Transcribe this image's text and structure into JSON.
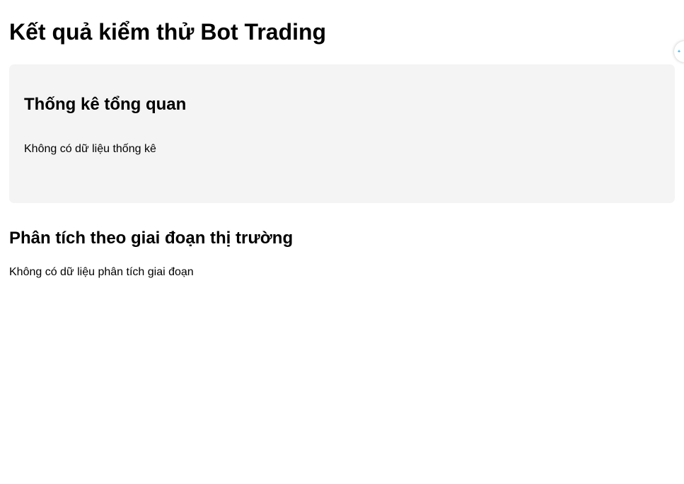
{
  "page": {
    "title": "Kết quả kiểm thử Bot Trading"
  },
  "stats": {
    "heading": "Thống kê tổng quan",
    "empty_text": "Không có dữ liệu thống kê"
  },
  "phase_analysis": {
    "heading": "Phân tích theo giai đoạn thị trường",
    "empty_text": "Không có dữ liệu phân tích giai đoạn"
  },
  "assistant": {
    "icon": "sparkle-icon",
    "accent_color": "#3aa7e0"
  }
}
